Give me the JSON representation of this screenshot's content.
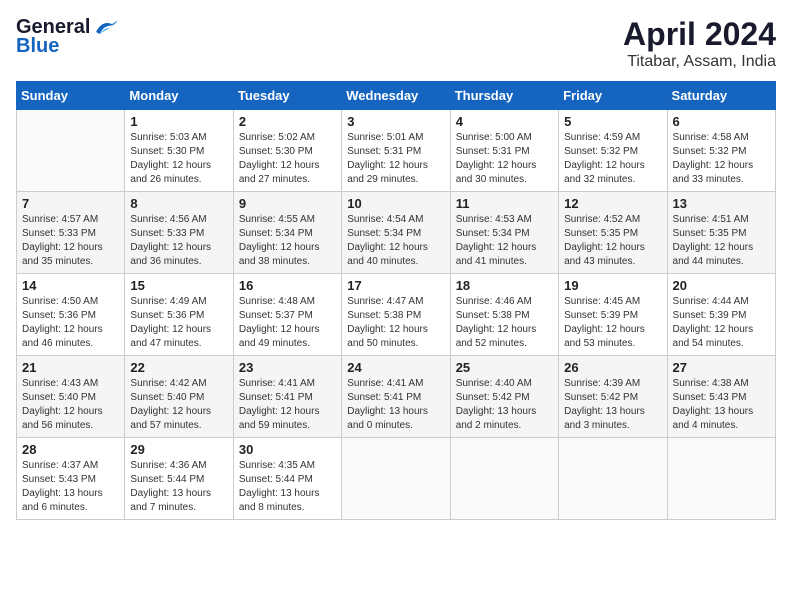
{
  "logo": {
    "general": "General",
    "blue": "Blue"
  },
  "title": "April 2024",
  "subtitle": "Titabar, Assam, India",
  "days_of_week": [
    "Sunday",
    "Monday",
    "Tuesday",
    "Wednesday",
    "Thursday",
    "Friday",
    "Saturday"
  ],
  "weeks": [
    [
      {
        "day": "",
        "detail": ""
      },
      {
        "day": "1",
        "detail": "Sunrise: 5:03 AM\nSunset: 5:30 PM\nDaylight: 12 hours\nand 26 minutes."
      },
      {
        "day": "2",
        "detail": "Sunrise: 5:02 AM\nSunset: 5:30 PM\nDaylight: 12 hours\nand 27 minutes."
      },
      {
        "day": "3",
        "detail": "Sunrise: 5:01 AM\nSunset: 5:31 PM\nDaylight: 12 hours\nand 29 minutes."
      },
      {
        "day": "4",
        "detail": "Sunrise: 5:00 AM\nSunset: 5:31 PM\nDaylight: 12 hours\nand 30 minutes."
      },
      {
        "day": "5",
        "detail": "Sunrise: 4:59 AM\nSunset: 5:32 PM\nDaylight: 12 hours\nand 32 minutes."
      },
      {
        "day": "6",
        "detail": "Sunrise: 4:58 AM\nSunset: 5:32 PM\nDaylight: 12 hours\nand 33 minutes."
      }
    ],
    [
      {
        "day": "7",
        "detail": "Sunrise: 4:57 AM\nSunset: 5:33 PM\nDaylight: 12 hours\nand 35 minutes."
      },
      {
        "day": "8",
        "detail": "Sunrise: 4:56 AM\nSunset: 5:33 PM\nDaylight: 12 hours\nand 36 minutes."
      },
      {
        "day": "9",
        "detail": "Sunrise: 4:55 AM\nSunset: 5:34 PM\nDaylight: 12 hours\nand 38 minutes."
      },
      {
        "day": "10",
        "detail": "Sunrise: 4:54 AM\nSunset: 5:34 PM\nDaylight: 12 hours\nand 40 minutes."
      },
      {
        "day": "11",
        "detail": "Sunrise: 4:53 AM\nSunset: 5:34 PM\nDaylight: 12 hours\nand 41 minutes."
      },
      {
        "day": "12",
        "detail": "Sunrise: 4:52 AM\nSunset: 5:35 PM\nDaylight: 12 hours\nand 43 minutes."
      },
      {
        "day": "13",
        "detail": "Sunrise: 4:51 AM\nSunset: 5:35 PM\nDaylight: 12 hours\nand 44 minutes."
      }
    ],
    [
      {
        "day": "14",
        "detail": "Sunrise: 4:50 AM\nSunset: 5:36 PM\nDaylight: 12 hours\nand 46 minutes."
      },
      {
        "day": "15",
        "detail": "Sunrise: 4:49 AM\nSunset: 5:36 PM\nDaylight: 12 hours\nand 47 minutes."
      },
      {
        "day": "16",
        "detail": "Sunrise: 4:48 AM\nSunset: 5:37 PM\nDaylight: 12 hours\nand 49 minutes."
      },
      {
        "day": "17",
        "detail": "Sunrise: 4:47 AM\nSunset: 5:38 PM\nDaylight: 12 hours\nand 50 minutes."
      },
      {
        "day": "18",
        "detail": "Sunrise: 4:46 AM\nSunset: 5:38 PM\nDaylight: 12 hours\nand 52 minutes."
      },
      {
        "day": "19",
        "detail": "Sunrise: 4:45 AM\nSunset: 5:39 PM\nDaylight: 12 hours\nand 53 minutes."
      },
      {
        "day": "20",
        "detail": "Sunrise: 4:44 AM\nSunset: 5:39 PM\nDaylight: 12 hours\nand 54 minutes."
      }
    ],
    [
      {
        "day": "21",
        "detail": "Sunrise: 4:43 AM\nSunset: 5:40 PM\nDaylight: 12 hours\nand 56 minutes."
      },
      {
        "day": "22",
        "detail": "Sunrise: 4:42 AM\nSunset: 5:40 PM\nDaylight: 12 hours\nand 57 minutes."
      },
      {
        "day": "23",
        "detail": "Sunrise: 4:41 AM\nSunset: 5:41 PM\nDaylight: 12 hours\nand 59 minutes."
      },
      {
        "day": "24",
        "detail": "Sunrise: 4:41 AM\nSunset: 5:41 PM\nDaylight: 13 hours\nand 0 minutes."
      },
      {
        "day": "25",
        "detail": "Sunrise: 4:40 AM\nSunset: 5:42 PM\nDaylight: 13 hours\nand 2 minutes."
      },
      {
        "day": "26",
        "detail": "Sunrise: 4:39 AM\nSunset: 5:42 PM\nDaylight: 13 hours\nand 3 minutes."
      },
      {
        "day": "27",
        "detail": "Sunrise: 4:38 AM\nSunset: 5:43 PM\nDaylight: 13 hours\nand 4 minutes."
      }
    ],
    [
      {
        "day": "28",
        "detail": "Sunrise: 4:37 AM\nSunset: 5:43 PM\nDaylight: 13 hours\nand 6 minutes."
      },
      {
        "day": "29",
        "detail": "Sunrise: 4:36 AM\nSunset: 5:44 PM\nDaylight: 13 hours\nand 7 minutes."
      },
      {
        "day": "30",
        "detail": "Sunrise: 4:35 AM\nSunset: 5:44 PM\nDaylight: 13 hours\nand 8 minutes."
      },
      {
        "day": "",
        "detail": ""
      },
      {
        "day": "",
        "detail": ""
      },
      {
        "day": "",
        "detail": ""
      },
      {
        "day": "",
        "detail": ""
      }
    ]
  ]
}
